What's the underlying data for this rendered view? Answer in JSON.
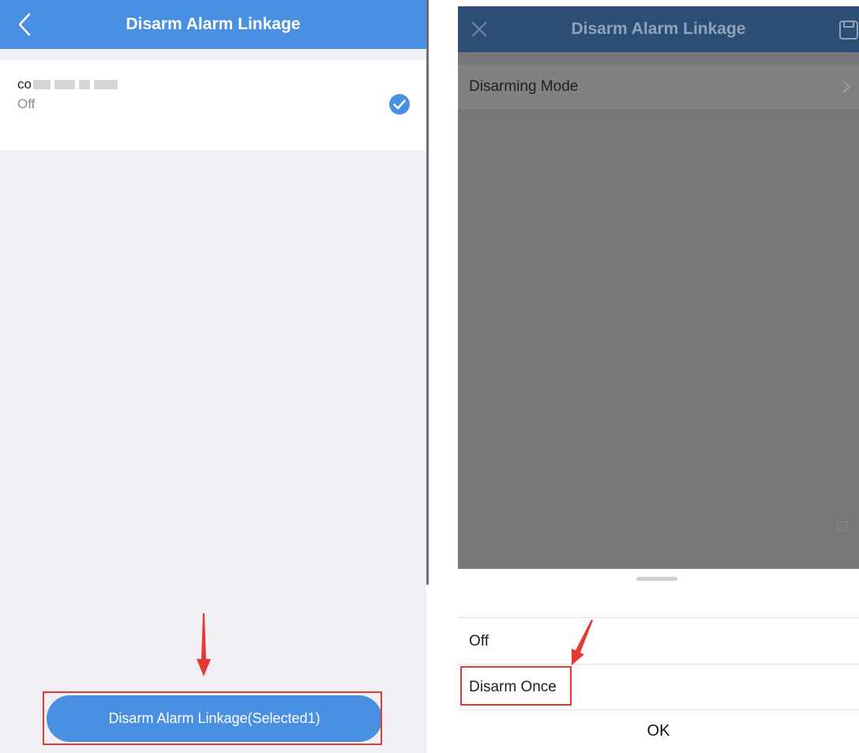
{
  "left_screen": {
    "header": {
      "title": "Disarm Alarm Linkage"
    },
    "device": {
      "name_visible": "co",
      "status": "Off",
      "selected": true
    },
    "bottom_button": {
      "label": "Disarm Alarm Linkage(Selected1)"
    }
  },
  "right_screen": {
    "header": {
      "title": "Disarm Alarm Linkage"
    },
    "setting": {
      "label": "Disarming Mode"
    },
    "sheet": {
      "options": [
        {
          "label": "Off"
        },
        {
          "label": "Disarm Once"
        }
      ],
      "confirm_label": "OK"
    }
  },
  "colors": {
    "left_header": "#4a90e2",
    "right_header": "#2d4e74",
    "overlay": "#777779",
    "highlight": "#e53935"
  },
  "icons": {
    "back": "back-arrow-icon",
    "check": "check-circle-icon",
    "close": "close-icon",
    "save": "save-icon",
    "chevron": "chevron-right-icon"
  }
}
